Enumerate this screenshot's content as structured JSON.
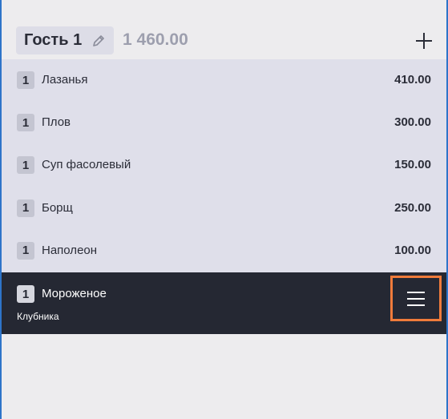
{
  "guest": {
    "name": "Гость 1",
    "total": "1 460.00"
  },
  "icons": {
    "edit": "pencil-icon",
    "add": "plus-icon",
    "menu": "hamburger-menu-icon"
  },
  "colors": {
    "header_bg": "#edecee",
    "list_bg": "#dfdfea",
    "selected_bg": "#252833",
    "highlight_border": "#ef7b3b",
    "frame_border": "#2e74c9"
  },
  "items": [
    {
      "qty": "1",
      "name": "Лазанья",
      "price": "410.00"
    },
    {
      "qty": "1",
      "name": "Плов",
      "price": "300.00"
    },
    {
      "qty": "1",
      "name": "Суп фасолевый",
      "price": "150.00"
    },
    {
      "qty": "1",
      "name": "Борщ",
      "price": "250.00"
    },
    {
      "qty": "1",
      "name": "Наполеон",
      "price": "100.00"
    }
  ],
  "selected_item": {
    "qty": "1",
    "name": "Мороженое",
    "modifier": "Клубника"
  }
}
